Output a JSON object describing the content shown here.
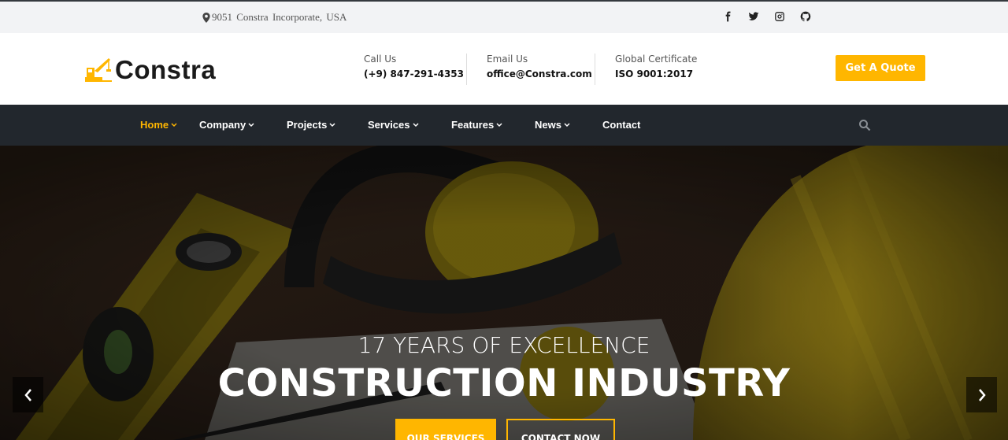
{
  "topbar": {
    "address": "9051 Constra Incorporate, USA",
    "social": [
      "facebook-icon",
      "twitter-icon",
      "instagram-icon",
      "github-icon"
    ]
  },
  "header": {
    "logo_text": "Constra",
    "call_label": "Call Us",
    "call_value": "(+9) 847-291-4353",
    "email_label": "Email Us",
    "email_value": "office@Constra.com",
    "cert_label": "Global Certificate",
    "cert_value": "ISO 9001:2017",
    "quote_button": "Get A Quote"
  },
  "nav": {
    "items": [
      {
        "label": "Home",
        "dropdown": true,
        "active": true
      },
      {
        "label": "Company",
        "dropdown": true
      },
      {
        "label": "Projects",
        "dropdown": true
      },
      {
        "label": "Services",
        "dropdown": true
      },
      {
        "label": "Features",
        "dropdown": true
      },
      {
        "label": "News",
        "dropdown": true
      },
      {
        "label": "Contact",
        "dropdown": false
      }
    ]
  },
  "hero": {
    "subtitle": "17 YEARS OF EXCELLENCE",
    "title": "CONSTRUCTION INDUSTRY",
    "primary_button": "OUR SERVICES",
    "secondary_button": "CONTACT NOW"
  },
  "colors": {
    "accent": "#ffb600",
    "nav_bg": "#22272d",
    "topbar_bg": "#f2f3f5"
  }
}
